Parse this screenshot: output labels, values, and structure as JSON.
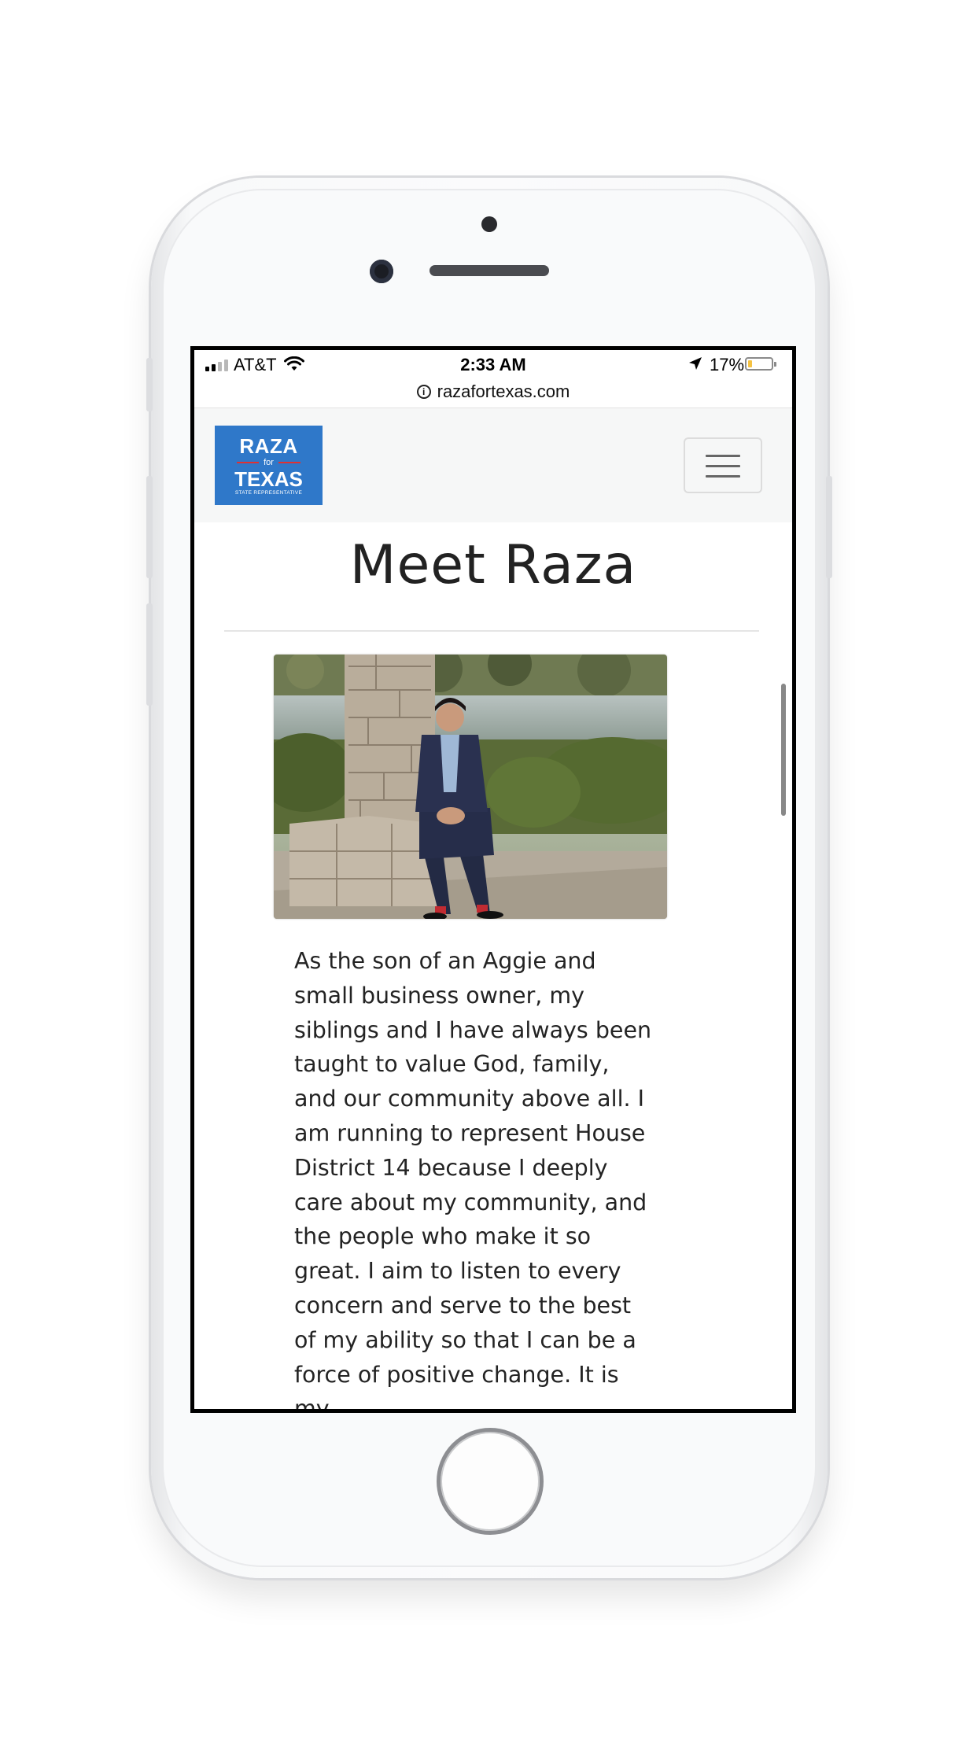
{
  "status_bar": {
    "carrier": "AT&T",
    "time": "2:33 AM",
    "battery_percent": "17%",
    "battery_level": 0.17,
    "signal_bars_active": 2,
    "signal_bars_total": 4,
    "icons": [
      "signal-icon",
      "wifi-icon",
      "location-arrow-icon",
      "battery-icon"
    ]
  },
  "browser": {
    "url": "razafortexas.com",
    "icon": "info-icon"
  },
  "header": {
    "logo": {
      "line1": "RAZA",
      "line2": "for",
      "line3": "TEXAS",
      "line4": "STATE REPRESENTATIVE"
    },
    "menu_icon": "hamburger-icon"
  },
  "main": {
    "title": "Meet Raza",
    "photo": "portrait-photo",
    "bio": "As the son of an Aggie and small business owner, my siblings and I have always been taught to value God, family, and our community above all. I am running to represent House District 14 because I deeply care about my community, and the people who make it so great. I aim to listen to every concern and serve to the best of my ability so that I can be a force of positive change. It is my"
  },
  "colors": {
    "logo_blue": "#2f78c9",
    "logo_accent_red": "#e03131",
    "header_bg": "#f6f7f7",
    "text": "#232323"
  }
}
